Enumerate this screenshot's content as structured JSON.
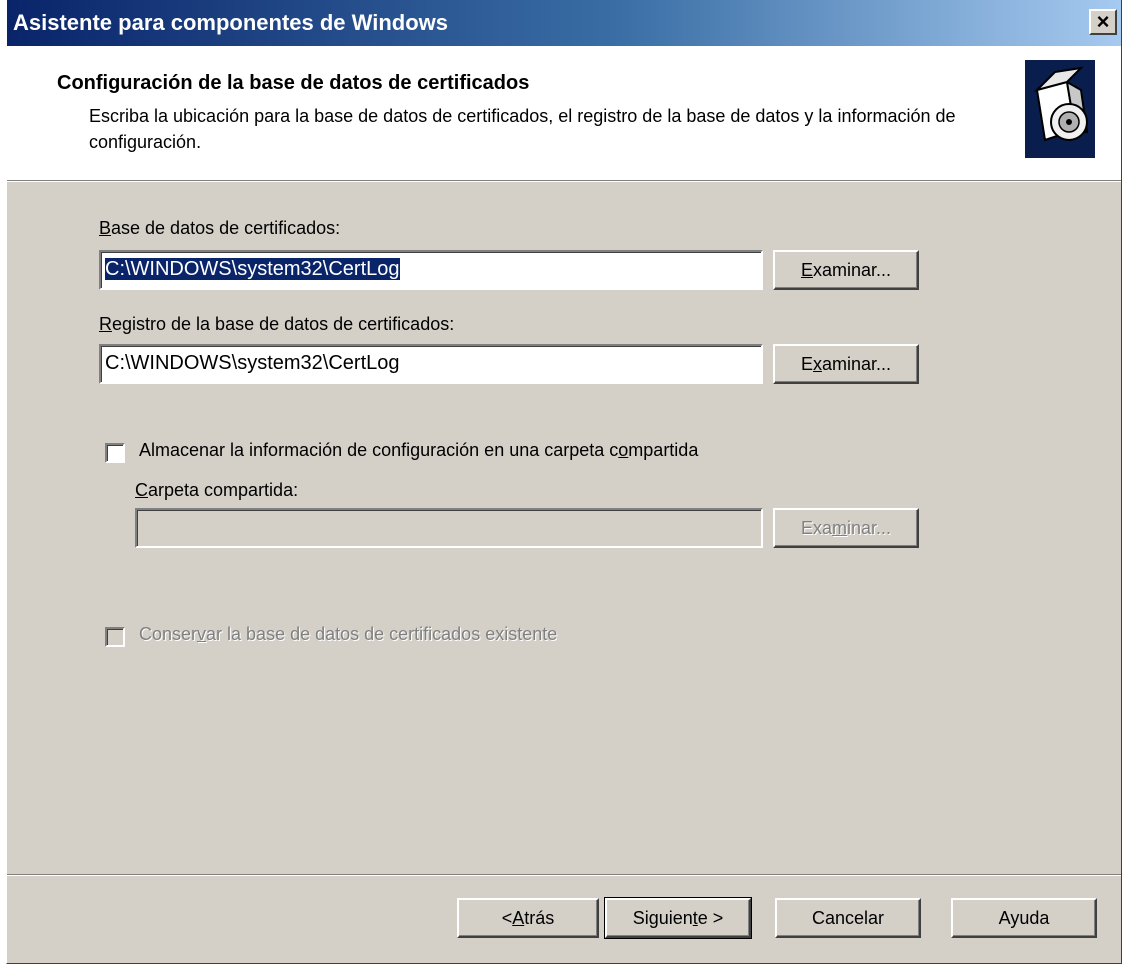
{
  "window": {
    "title": "Asistente para componentes de Windows",
    "close_label": "×"
  },
  "header": {
    "title": "Configuración de la base de datos de certificados",
    "subtitle": "Escriba la ubicación para la base de datos de certificados, el registro de la base de datos y la información de configuración.",
    "icon": "setup-cd-box-icon"
  },
  "form": {
    "db_label_key": "B",
    "db_label_rest": "ase de datos de certificados:",
    "db_value": "C:\\WINDOWS\\system32\\CertLog",
    "db_browse_key": "E",
    "db_browse_rest": "xaminar...",
    "log_label_key": "R",
    "log_label_rest": "egistro de la base de datos de certificados:",
    "log_value": "C:\\WINDOWS\\system32\\CertLog",
    "log_browse_pre": "E",
    "log_browse_key": "x",
    "log_browse_rest": "aminar...",
    "shared_checkbox_pre": "Almacenar la información de configuración en una carpeta c",
    "shared_checkbox_key": "o",
    "shared_checkbox_rest": "mpartida",
    "shared_checked": false,
    "shared_folder_label_key": "C",
    "shared_folder_label_rest": "arpeta compartida:",
    "shared_folder_value": "",
    "shared_browse_pre": "Exa",
    "shared_browse_key": "m",
    "shared_browse_rest": "inar...",
    "preserve_pre": "Conser",
    "preserve_key": "v",
    "preserve_rest": "ar la base de datos de certificados existente",
    "preserve_checked": false
  },
  "footer": {
    "back_pre": "< ",
    "back_key": "A",
    "back_rest": "trás",
    "next_pre": "Siguien",
    "next_key": "t",
    "next_rest": "e >",
    "cancel_label": "Cancelar",
    "help_label": "Ayuda"
  },
  "colors": {
    "titlebar_start": "#0a246a",
    "titlebar_end": "#a6caf0",
    "dialog_face": "#d4d0c8",
    "selection": "#0a246a"
  }
}
